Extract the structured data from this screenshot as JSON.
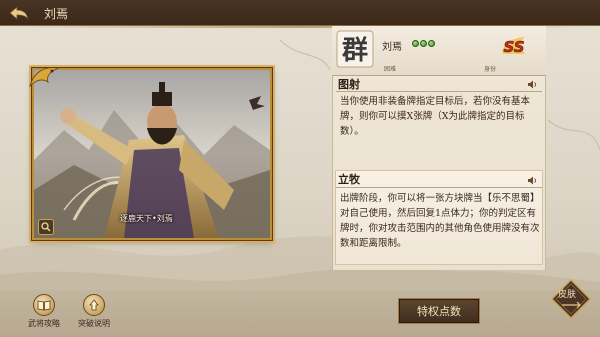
{
  "topbar": {
    "title": "刘焉"
  },
  "portrait": {
    "caption": "逐鹿天下•刘焉"
  },
  "character": {
    "seal_char": "群",
    "name": "刘焉",
    "difficulty_count": 3,
    "difficulty_label": "困难",
    "identity_label": "身份",
    "rank": "SS"
  },
  "skills": [
    {
      "title": "图射",
      "body": "当你使用非装备牌指定目标后，若你没有基本牌，则你可以摸X张牌（X为此牌指定的目标数）。"
    },
    {
      "title": "立牧",
      "body": "出牌阶段，你可以将一张方块牌当【乐不思蜀】对自己使用，然后回复1点体力；你的判定区有牌时，你对攻击范围内的其他角色使用牌没有次数和距离限制。"
    }
  ],
  "bottom": {
    "guide_label": "武将攻略",
    "breakthrough_label": "突破说明",
    "privilege_label": "特权点数",
    "skin_label": "皮肤"
  },
  "colors": {
    "accent_gold": "#b8903a",
    "dark_brown": "#3e2c1e",
    "difficulty_green": "#4a8a2a",
    "rank_red": "#c0301c"
  }
}
